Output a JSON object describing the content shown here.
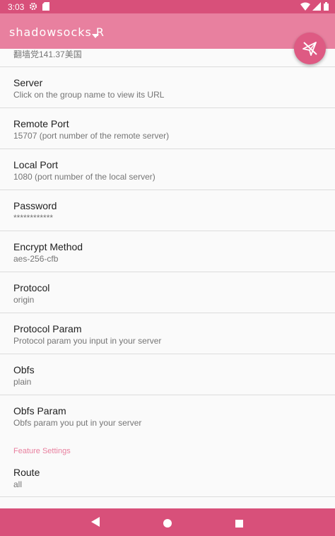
{
  "status_bar": {
    "time": "3:03",
    "icons": [
      "settings-icon",
      "sim-card-icon",
      "wifi-icon",
      "signal-icon",
      "battery-icon"
    ]
  },
  "app_bar": {
    "title": "shadowsocks R",
    "dropdown_icon": "chevron-down-icon",
    "color": "#e8809f"
  },
  "fab": {
    "icon": "paper-plane-disconnected-icon",
    "color": "#de5a83"
  },
  "list": {
    "partial_item_text": "翻墙党141.37美国",
    "items": [
      {
        "title": "Server",
        "subtitle": "Click on the group name to view its URL"
      },
      {
        "title": "Remote Port",
        "subtitle": "15707 (port number of the remote server)"
      },
      {
        "title": "Local Port",
        "subtitle": "1080 (port number of the local server)"
      },
      {
        "title": "Password",
        "subtitle": "************"
      },
      {
        "title": "Encrypt Method",
        "subtitle": "aes-256-cfb"
      },
      {
        "title": "Protocol",
        "subtitle": "origin"
      },
      {
        "title": "Protocol Param",
        "subtitle": "Protocol param you input in your server"
      },
      {
        "title": "Obfs",
        "subtitle": "plain"
      },
      {
        "title": "Obfs Param",
        "subtitle": "Obfs param you put in your server"
      }
    ],
    "section_header": "Feature Settings",
    "route": {
      "title": "Route",
      "subtitle": "all"
    }
  },
  "nav_bar": {
    "icons": [
      "back-icon",
      "home-icon",
      "recents-icon"
    ],
    "color": "#d8507a"
  }
}
